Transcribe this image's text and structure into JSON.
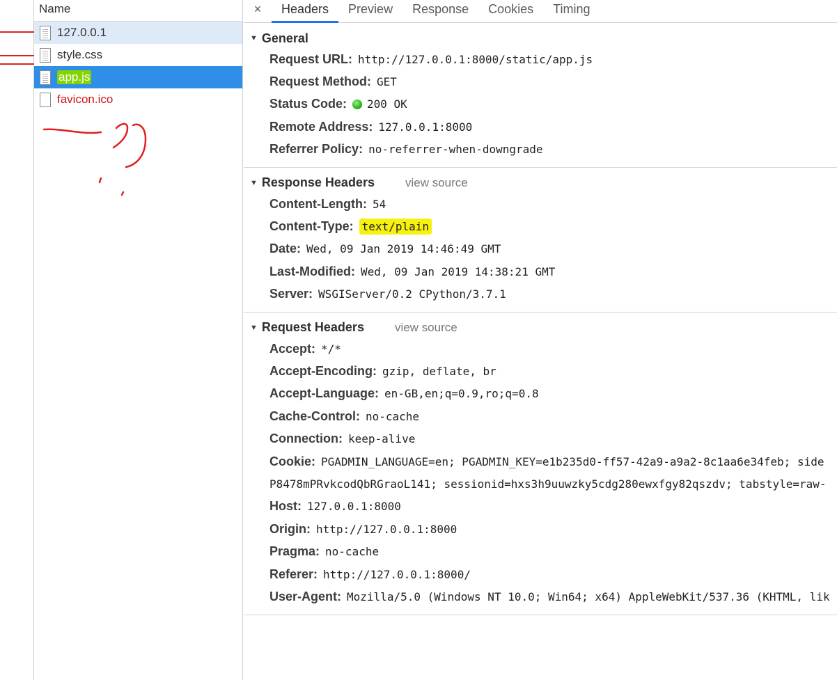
{
  "name_column": {
    "header": "Name",
    "requests": [
      {
        "label": "127.0.0.1"
      },
      {
        "label": "style.css"
      },
      {
        "label": "app.js"
      },
      {
        "label": "favicon.ico"
      }
    ]
  },
  "tabs": {
    "close": "×",
    "items": [
      "Headers",
      "Preview",
      "Response",
      "Cookies",
      "Timing"
    ]
  },
  "general": {
    "title": "General",
    "rows": [
      {
        "key": "Request URL:",
        "value": "http://127.0.0.1:8000/static/app.js"
      },
      {
        "key": "Request Method:",
        "value": "GET"
      },
      {
        "key": "Status Code:",
        "value": "200 OK"
      },
      {
        "key": "Remote Address:",
        "value": "127.0.0.1:8000"
      },
      {
        "key": "Referrer Policy:",
        "value": "no-referrer-when-downgrade"
      }
    ]
  },
  "response_headers": {
    "title": "Response Headers",
    "view_source": "view source",
    "rows": [
      {
        "key": "Content-Length:",
        "value": "54"
      },
      {
        "key": "Content-Type:",
        "value": "text/plain"
      },
      {
        "key": "Date:",
        "value": "Wed, 09 Jan 2019 14:46:49 GMT"
      },
      {
        "key": "Last-Modified:",
        "value": "Wed, 09 Jan 2019 14:38:21 GMT"
      },
      {
        "key": "Server:",
        "value": "WSGIServer/0.2 CPython/3.7.1"
      }
    ]
  },
  "request_headers": {
    "title": "Request Headers",
    "view_source": "view source",
    "rows": [
      {
        "key": "Accept:",
        "value": "*/*"
      },
      {
        "key": "Accept-Encoding:",
        "value": "gzip, deflate, br"
      },
      {
        "key": "Accept-Language:",
        "value": "en-GB,en;q=0.9,ro;q=0.8"
      },
      {
        "key": "Cache-Control:",
        "value": "no-cache"
      },
      {
        "key": "Connection:",
        "value": "keep-alive"
      },
      {
        "key": "Cookie:",
        "value": "PGADMIN_LANGUAGE=en; PGADMIN_KEY=e1b235d0-ff57-42a9-a9a2-8c1aa6e34feb; side"
      },
      {
        "key": "",
        "value": "P8478mPRvkcodQbRGraoL141; sessionid=hxs3h9uuwzky5cdg280ewxfgy82qszdv; tabstyle=raw-"
      },
      {
        "key": "Host:",
        "value": "127.0.0.1:8000"
      },
      {
        "key": "Origin:",
        "value": "http://127.0.0.1:8000"
      },
      {
        "key": "Pragma:",
        "value": "no-cache"
      },
      {
        "key": "Referer:",
        "value": "http://127.0.0.1:8000/"
      },
      {
        "key": "User-Agent:",
        "value": "Mozilla/5.0 (Windows NT 10.0; Win64; x64) AppleWebKit/537.36 (KHTML, lik"
      }
    ]
  }
}
